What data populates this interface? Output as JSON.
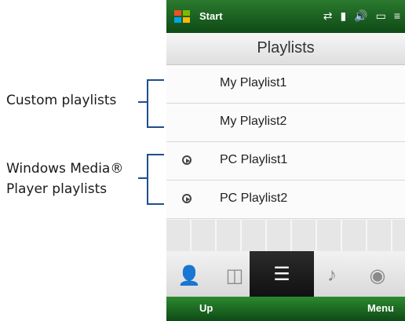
{
  "callouts": {
    "custom_label": "Custom playlists",
    "wm_line1": "Windows Media®",
    "wm_line2": "Player playlists"
  },
  "phone": {
    "status": {
      "start_label": "Start",
      "icons": [
        "sync-icon",
        "signal-icon",
        "volume-icon",
        "battery-icon",
        "menu-icon"
      ]
    },
    "title": "Playlists",
    "playlists": [
      {
        "label": "My Playlist1",
        "pc": false
      },
      {
        "label": "My Playlist2",
        "pc": false
      },
      {
        "label": "PC Playlist1",
        "pc": true
      },
      {
        "label": "PC Playlist2",
        "pc": true
      }
    ],
    "tabs": [
      {
        "name": "artists-tab",
        "icon": "person-icon",
        "active": false
      },
      {
        "name": "albums-tab",
        "icon": "cd-icon",
        "active": false
      },
      {
        "name": "playlists-tab",
        "icon": "playlist-icon",
        "active": true
      },
      {
        "name": "songs-tab",
        "icon": "music-note-icon",
        "active": false
      },
      {
        "name": "genre-tab",
        "icon": "disc-icon",
        "active": false
      }
    ],
    "softkeys": {
      "left": "Up",
      "right": "Menu"
    },
    "colors": {
      "statusbar_green": "#1f6a25",
      "accent_dark": "#111111"
    }
  }
}
